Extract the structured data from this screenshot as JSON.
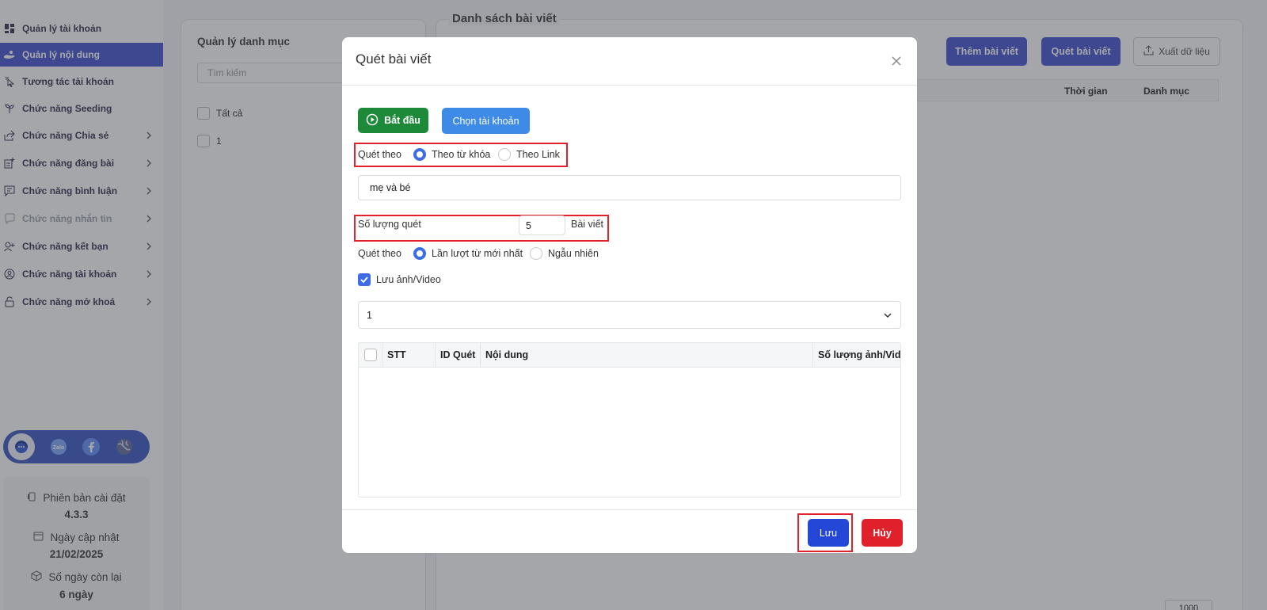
{
  "sidebar": {
    "items": [
      {
        "label": "Quản lý tài khoản",
        "icon": "dashboard-icon",
        "active": false,
        "chevron": false,
        "disabled": false
      },
      {
        "label": "Quản lý nội dung",
        "icon": "content-hand-icon",
        "active": true,
        "chevron": false,
        "disabled": false
      },
      {
        "label": "Tương tác tài khoản",
        "icon": "pointer-click-icon",
        "active": false,
        "chevron": false,
        "disabled": false
      },
      {
        "label": "Chức năng Seeding",
        "icon": "seeding-icon",
        "active": false,
        "chevron": false,
        "disabled": false
      },
      {
        "label": "Chức năng Chia sẻ",
        "icon": "share-icon",
        "active": false,
        "chevron": true,
        "disabled": false
      },
      {
        "label": "Chức năng đăng bài",
        "icon": "post-add-icon",
        "active": false,
        "chevron": true,
        "disabled": false
      },
      {
        "label": "Chức năng bình luận",
        "icon": "comment-icon",
        "active": false,
        "chevron": true,
        "disabled": false
      },
      {
        "label": "Chức năng nhắn tin",
        "icon": "message-icon",
        "active": false,
        "chevron": true,
        "disabled": true
      },
      {
        "label": "Chức năng kết bạn",
        "icon": "add-friend-icon",
        "active": false,
        "chevron": true,
        "disabled": false
      },
      {
        "label": "Chức năng tài khoản",
        "icon": "account-circle-icon",
        "active": false,
        "chevron": true,
        "disabled": false
      },
      {
        "label": "Chức năng mở khoá",
        "icon": "unlock-icon",
        "active": false,
        "chevron": true,
        "disabled": false
      }
    ],
    "social": [
      "support-headset-icon",
      "zalo-icon",
      "facebook-icon",
      "globe-icon"
    ],
    "version": {
      "version_label": "Phiên bản cài đặt",
      "version_value": "4.3.3",
      "updated_label": "Ngày cập nhật",
      "updated_value": "21/02/2025",
      "days_label": "Số ngày còn lại",
      "days_value": "6 ngày"
    }
  },
  "background": {
    "category_title": "Quản lý danh mục",
    "search_placeholder": "Tìm kiếm",
    "all_label": "Tất cả",
    "row_1": "1",
    "list_title": "Danh sách bài viết",
    "add_post": "Thêm bài viết",
    "scan_post": "Quét bài viết",
    "export": "Xuất dữ liệu",
    "col_time": "Thời gian",
    "col_category": "Danh mục",
    "footer_dots": "...",
    "page_size": "1000"
  },
  "modal": {
    "title": "Quét bài viết",
    "start_button": "Bắt đầu",
    "choose_account_button": "Chọn tài khoản",
    "scan_by_label": "Quét theo",
    "scan_by_options": [
      "Theo từ khóa",
      "Theo Link"
    ],
    "scan_by_selected": 0,
    "keyword_value": "mẹ và bé",
    "quantity_label": "Số lượng quét",
    "quantity_value": "5",
    "quantity_unit": "Bài viết",
    "order_label": "Quét theo",
    "order_options": [
      "Lần lượt từ mới nhất",
      "Ngẫu nhiên"
    ],
    "order_selected": 0,
    "save_media_label": "Lưu ảnh/Video",
    "save_media_checked": true,
    "account_select_value": "1",
    "table_headers": [
      "STT",
      "ID Quét",
      "Nội dung",
      "Số lượng ảnh/Video"
    ],
    "save_button": "Lưu",
    "cancel_button": "Hủy"
  },
  "colors": {
    "primary": "#3d4fd0",
    "start_green": "#1d8a3a",
    "choose_blue": "#3d8be6",
    "save_blue": "#2447d8",
    "cancel_red": "#e0202a",
    "highlight_red": "#e0202a"
  }
}
